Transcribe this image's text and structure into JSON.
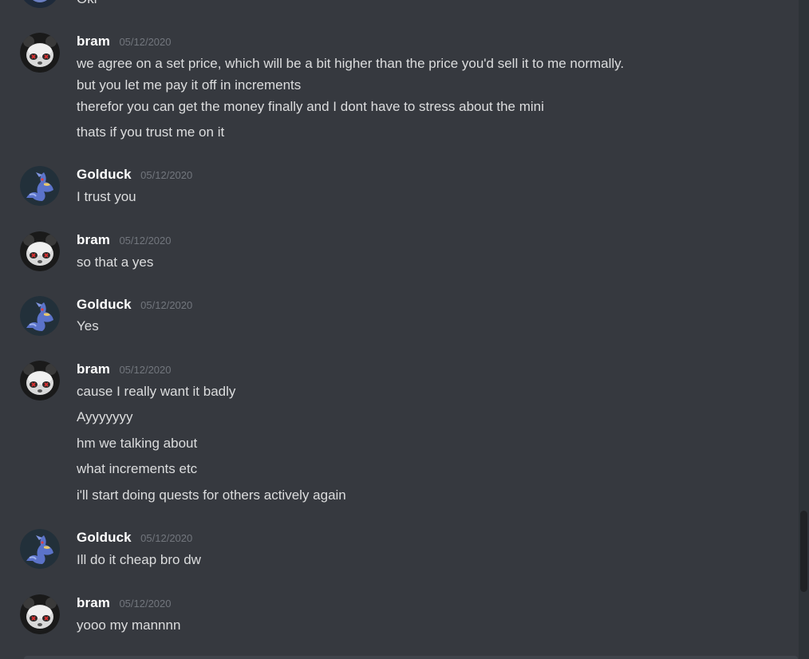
{
  "chat": {
    "top_partial_text": "Oki",
    "groups": [
      {
        "username": "bram",
        "timestamp": "05/12/2020",
        "avatar": "bram-avatar",
        "lines": [
          "we agree on a set price, which will be a bit higher than the price you'd sell it to me normally.",
          "but you let me pay it off in increments",
          "therefor you can get the money finally and I dont have to stress about the mini",
          "thats if you trust me on it"
        ]
      },
      {
        "username": "Golduck",
        "timestamp": "05/12/2020",
        "avatar": "golduck-avatar",
        "lines": [
          "I trust you"
        ]
      },
      {
        "username": "bram",
        "timestamp": "05/12/2020",
        "avatar": "bram-avatar",
        "lines": [
          "so that a yes"
        ]
      },
      {
        "username": "Golduck",
        "timestamp": "05/12/2020",
        "avatar": "golduck-avatar",
        "lines": [
          "Yes"
        ]
      },
      {
        "username": "bram",
        "timestamp": "05/12/2020",
        "avatar": "bram-avatar",
        "lines": [
          "cause I really want it badly",
          "Ayyyyyyy",
          "hm we talking about",
          "what increments etc",
          "i'll start doing quests for others actively again"
        ]
      },
      {
        "username": "Golduck",
        "timestamp": "05/12/2020",
        "avatar": "golduck-avatar",
        "lines": [
          "Ill do it cheap bro dw"
        ]
      },
      {
        "username": "bram",
        "timestamp": "05/12/2020",
        "avatar": "bram-avatar",
        "lines": [
          "yooo my mannnn"
        ]
      }
    ]
  },
  "colors": {
    "background": "#36393f",
    "username": "#ffffff",
    "message_text": "#dcddde",
    "timestamp": "#72767d",
    "scrollbar_track": "#2e3338",
    "scrollbar_thumb": "#202225"
  }
}
